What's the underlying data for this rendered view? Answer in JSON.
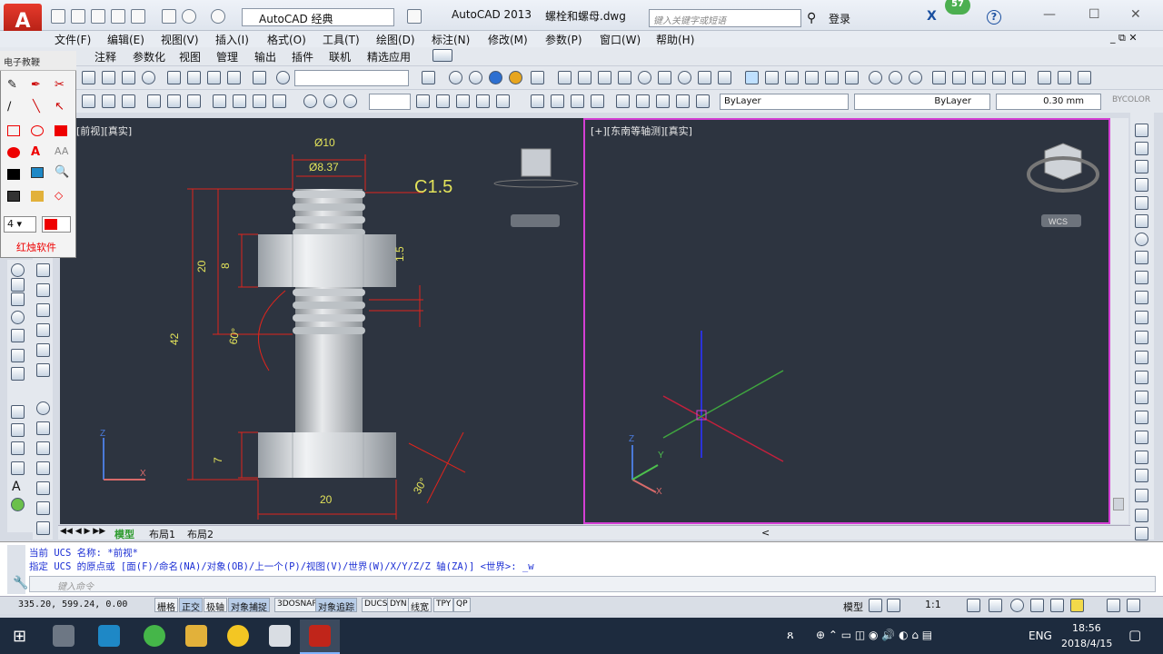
{
  "title_bar": {
    "workspace": "AutoCAD 经典",
    "app_name": "AutoCAD 2013",
    "document": "螺栓和螺母.dwg",
    "search_placeholder": "键入关键字或短语",
    "login": "登录",
    "notification_count": "57"
  },
  "menu": [
    "文件(F)",
    "编辑(E)",
    "视图(V)",
    "插入(I)",
    "格式(O)",
    "工具(T)",
    "绘图(D)",
    "标注(N)",
    "修改(M)",
    "参数(P)",
    "窗口(W)",
    "帮助(H)"
  ],
  "ribbon_tabs": [
    "注释",
    "参数化",
    "视图",
    "管理",
    "输出",
    "插件",
    "联机",
    "精选应用"
  ],
  "properties": {
    "color": "ByLayer",
    "linetype": "ByLayer",
    "lineweight": "0.30 mm",
    "plotstyle": "BYCOLOR"
  },
  "float_panel": {
    "title": "电子教鞭",
    "line_width": "4",
    "footer": "红烛软件"
  },
  "viewports": {
    "left_label": "[前视][真实]",
    "right_label": "[+][东南等轴测][真实]",
    "wcs": "WCS"
  },
  "dimensions": {
    "d10": "Ø10",
    "d837": "Ø8.37",
    "chamfer": "C1.5",
    "len20": "20",
    "len8": "8",
    "len42": "42",
    "ang60": "60°",
    "len7": "7",
    "len15": "1.5",
    "width20": "20",
    "ang30": "30°"
  },
  "layout_tabs": [
    "模型",
    "布局1",
    "布局2"
  ],
  "command": {
    "line1": "当前 UCS 名称:  *前视*",
    "line2": "指定 UCS 的原点或 [面(F)/命名(NA)/对象(OB)/上一个(P)/视图(V)/世界(W)/X/Y/Z/Z 轴(ZA)] <世界>: _w",
    "input_placeholder": "键入命令"
  },
  "status": {
    "coords": "335.20, 599.24, 0.00",
    "toggles": [
      "栅格",
      "正交",
      "极轴",
      "对象捕捉",
      "3DOSNAP",
      "对象追踪",
      "DUCS",
      "DYN",
      "线宽",
      "TPY",
      "QP"
    ],
    "space": "模型",
    "scale": "1:1"
  },
  "taskbar": {
    "lang": "ENG",
    "time": "18:56",
    "date": "2018/4/15"
  },
  "colors": {
    "canvas": "#2d3440",
    "dimension": "#e0241c",
    "dim_text": "#e3e35a",
    "active_viewport": "#d43fd4"
  }
}
